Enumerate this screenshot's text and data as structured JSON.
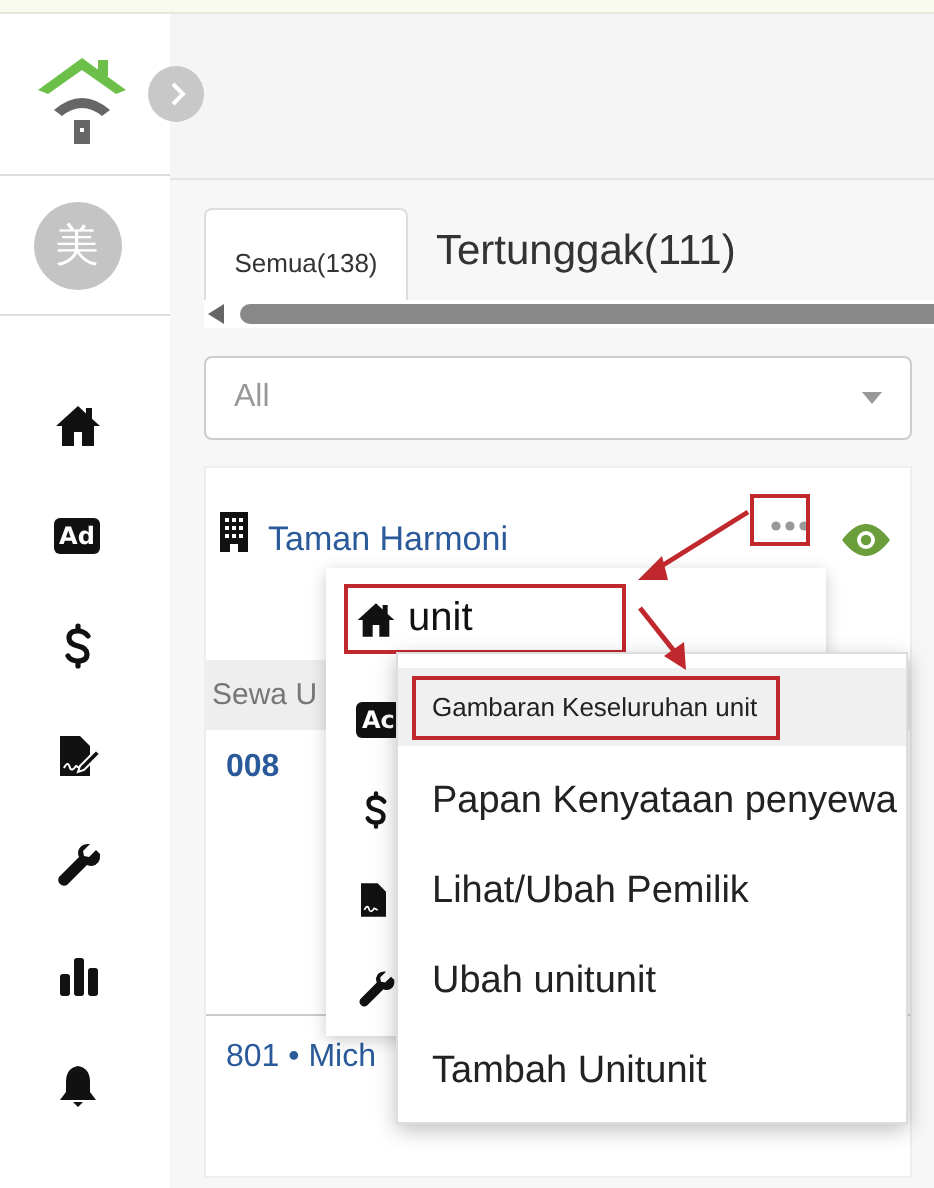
{
  "sidebar": {
    "avatar": "美",
    "nav": [
      {
        "kind": "home"
      },
      {
        "kind": "ad",
        "badge": "Ad"
      },
      {
        "kind": "dollar"
      },
      {
        "kind": "contract"
      },
      {
        "kind": "wrench"
      },
      {
        "kind": "chart"
      },
      {
        "kind": "bell"
      }
    ]
  },
  "tabs": [
    {
      "label": "Semua(138)",
      "selected": true
    },
    {
      "label": "Tertunggak(111)",
      "selected": false
    }
  ],
  "filter": {
    "value": "All"
  },
  "card": {
    "title": "Taman Harmoni",
    "menu_button_annotated": true,
    "column_header": "Sewa U",
    "rows": [
      {
        "label": "008"
      },
      {
        "label": "801 • Mich"
      }
    ]
  },
  "menu": {
    "items": [
      {
        "kind": "home",
        "label": "unit",
        "annotated": true
      },
      {
        "kind": "ad",
        "badge": "Ac",
        "annotated": false
      },
      {
        "kind": "dollar",
        "annotated": false
      },
      {
        "kind": "contract",
        "annotated": false
      },
      {
        "kind": "wrench",
        "annotated": false
      }
    ]
  },
  "submenu": {
    "items": [
      {
        "label": "Gambaran Keseluruhan unit",
        "selected": true,
        "annotated": true
      },
      {
        "label": "Papan Kenyataan penyewa",
        "selected": false,
        "annotated": false
      },
      {
        "label": "Lihat/Ubah Pemilik",
        "selected": false,
        "annotated": false
      },
      {
        "label": "Ubah unitunit",
        "selected": false,
        "annotated": false
      },
      {
        "label": "Tambah Unitunit",
        "selected": false,
        "annotated": false
      }
    ]
  }
}
